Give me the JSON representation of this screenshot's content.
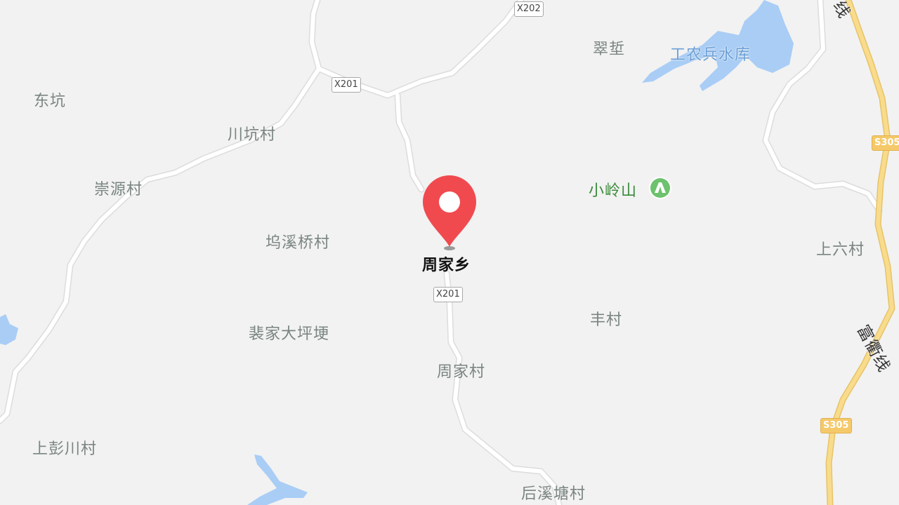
{
  "map": {
    "colors": {
      "background": "#f2f2f2",
      "water": "#a9cdf5",
      "road_minor": "#ffffff",
      "road_major": "#f9dc8b",
      "pin": "#f04a4f",
      "park_icon": "#6dc26d"
    },
    "selected_place": {
      "name": "周家乡",
      "icon": "map-pin-icon"
    },
    "labels": {
      "cuigang": "翠埑",
      "reservoir": "工农兵水库",
      "dongkeng": "东坑",
      "chuankeng": "川坑村",
      "chongyuan": "崇源村",
      "xiaolingshan": "小岭山",
      "wuxiqiao": "坞溪桥村",
      "shangliu": "上六村",
      "feijia": "裴家大坪埂",
      "fengcun": "丰村",
      "zhoujiacun": "周家村",
      "shangpengchuan": "上彭川村",
      "houxitang": "后溪塘村",
      "fuqu_line": "富衢线",
      "fuqu_top": "线"
    },
    "road_shields": {
      "x202": "X202",
      "x201_top": "X201",
      "x201_mid": "X201",
      "s305_top": "S305",
      "s305_bottom": "S305"
    },
    "poi_icons": {
      "xiaolingshan": "mountain-icon"
    }
  }
}
